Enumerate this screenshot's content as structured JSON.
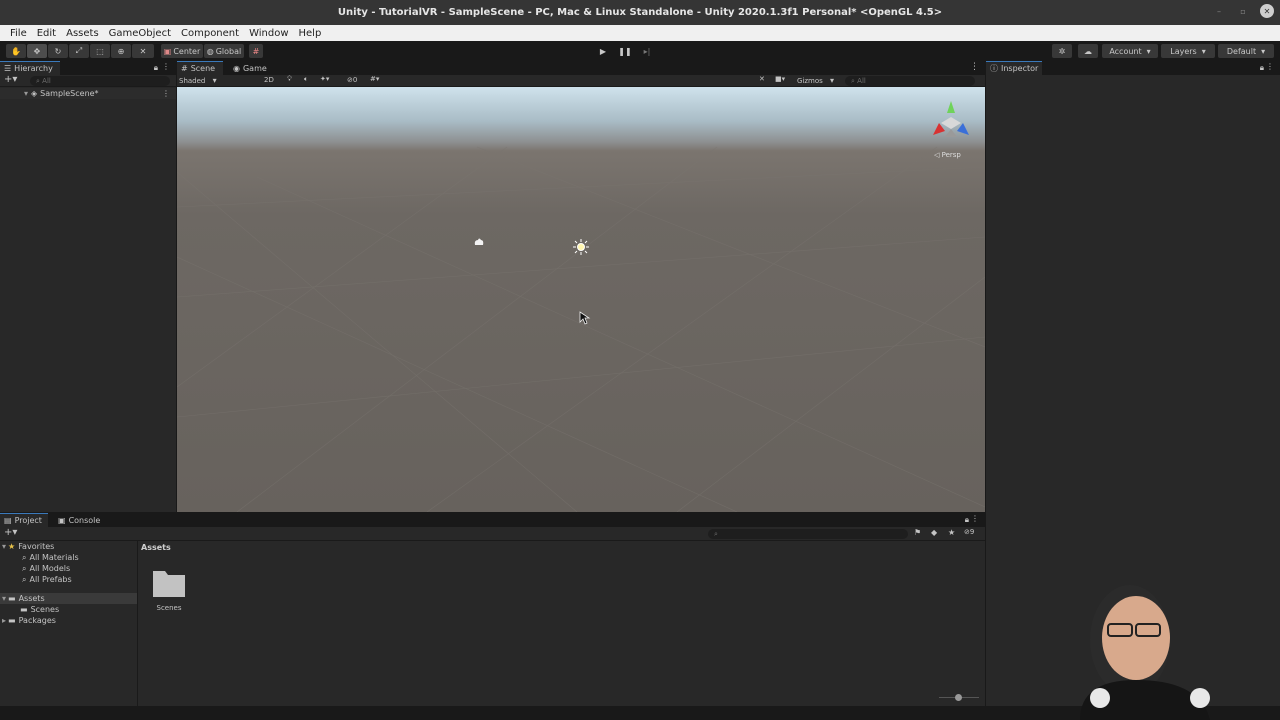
{
  "window": {
    "title": "Unity - TutorialVR - SampleScene - PC, Mac & Linux Standalone - Unity 2020.1.3f1 Personal* <OpenGL 4.5>"
  },
  "menu": [
    "File",
    "Edit",
    "Assets",
    "GameObject",
    "Component",
    "Window",
    "Help"
  ],
  "toolbar": {
    "pivot_label": "Center",
    "space_label": "Global",
    "account_label": "Account",
    "layers_label": "Layers",
    "layout_label": "Default"
  },
  "hierarchy": {
    "tab_label": "Hierarchy",
    "search_placeholder": "All",
    "scene_name": "SampleScene*"
  },
  "scene_view": {
    "tabs": [
      "Scene",
      "Game"
    ],
    "shading_mode": "Shaded",
    "mode_2d_label": "2D",
    "hidden_count": "0",
    "gizmos_label": "Gizmos",
    "search_placeholder": "All",
    "persp_label": "Persp"
  },
  "inspector": {
    "tab_label": "Inspector"
  },
  "project": {
    "tabs": [
      "Project",
      "Console"
    ],
    "favorites_label": "Favorites",
    "favorites": [
      "All Materials",
      "All Models",
      "All Prefabs"
    ],
    "assets_label": "Assets",
    "assets_children": [
      "Scenes"
    ],
    "packages_label": "Packages",
    "breadcrumb": "Assets",
    "hidden_packages_count": "9",
    "items": [
      {
        "name": "Scenes",
        "icon": "folder-icon"
      }
    ]
  },
  "colors": {
    "accent": "#3a79bb",
    "panel": "#282828",
    "toolbar": "#191919",
    "menubar": "#f0f0f0"
  }
}
